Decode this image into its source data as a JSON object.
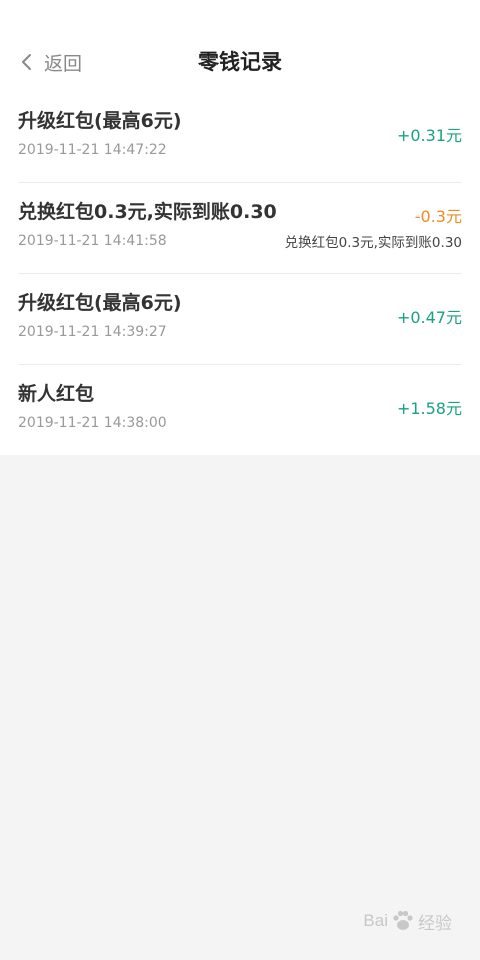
{
  "header": {
    "back_label": "返回",
    "title": "零钱记录"
  },
  "records": [
    {
      "title": "升级红包(最高6元)",
      "time": "2019-11-21 14:47:22",
      "amount": "+0.31元",
      "amount_color": "#1aa085",
      "note": ""
    },
    {
      "title": "兑换红包0.3元,实际到账0.30",
      "time": "2019-11-21 14:41:58",
      "amount": "-0.3元",
      "amount_color": "#f08a24",
      "note": "兑换红包0.3元,实际到账0.30"
    },
    {
      "title": "升级红包(最高6元)",
      "time": "2019-11-21 14:39:27",
      "amount": "+0.47元",
      "amount_color": "#1aa085",
      "note": ""
    },
    {
      "title": "新人红包",
      "time": "2019-11-21 14:38:00",
      "amount": "+1.58元",
      "amount_color": "#1aa085",
      "note": ""
    }
  ],
  "watermark": {
    "left_text": "Bai",
    "right_text": "经验",
    "icon": "paw-icon"
  }
}
